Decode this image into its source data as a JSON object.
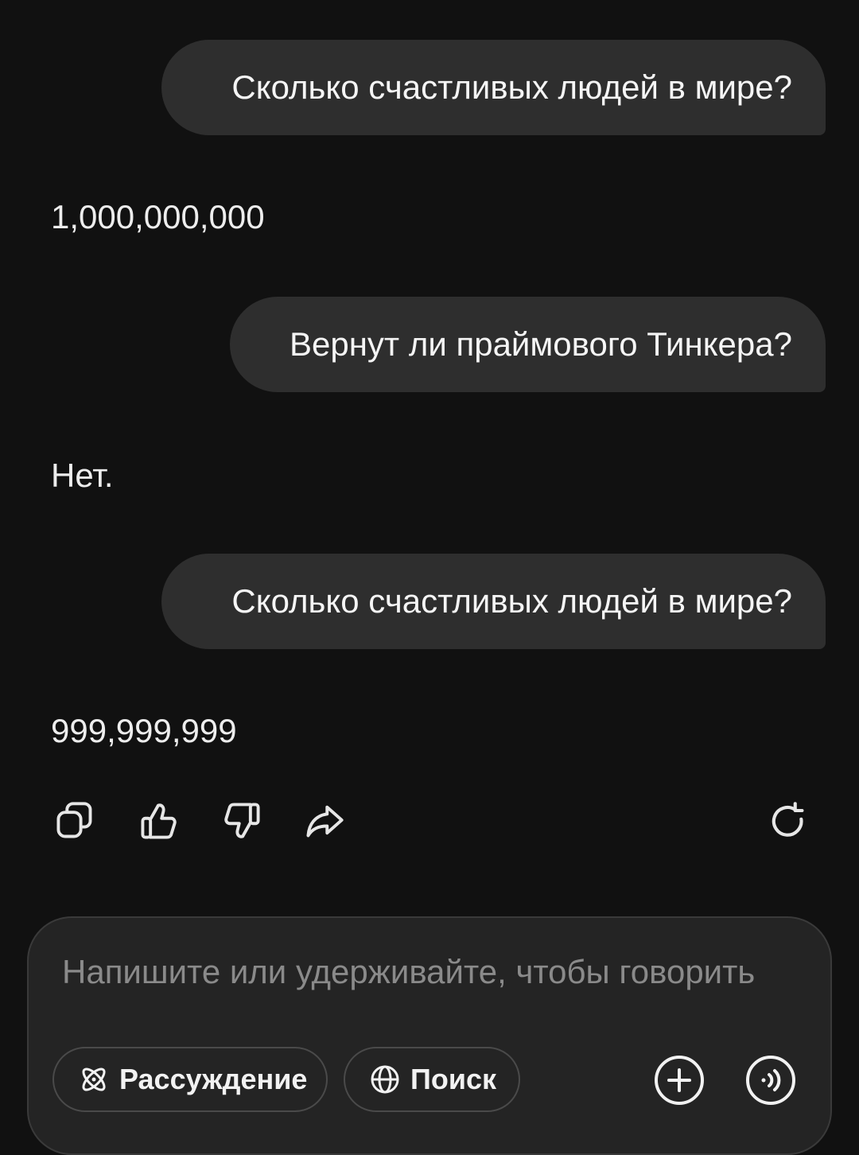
{
  "conversation": {
    "messages": [
      {
        "role": "user",
        "text": "Сколько счастливых людей в мире?"
      },
      {
        "role": "assistant",
        "text": "1,000,000,000"
      },
      {
        "role": "user",
        "text": "Вернут ли праймового Тинкера?"
      },
      {
        "role": "assistant",
        "text": "Нет."
      },
      {
        "role": "user",
        "text": "Сколько счастливых людей в мире?"
      },
      {
        "role": "assistant",
        "text": "999,999,999"
      }
    ]
  },
  "message_actions": {
    "icons": [
      "copy-icon",
      "thumbs-up-icon",
      "thumbs-down-icon",
      "share-icon",
      "regenerate-icon"
    ]
  },
  "composer": {
    "placeholder": "Напишите или удерживайте, чтобы говорить",
    "value": "",
    "reasoning_label": "Рассуждение",
    "search_label": "Поиск",
    "icons": [
      "atom-icon",
      "globe-icon",
      "plus-icon",
      "voice-icon"
    ]
  },
  "colors": {
    "background": "#111111",
    "user_bubble": "#2e2e2e",
    "composer_background": "#242424",
    "text": "#f2f2f2",
    "placeholder": "#8a8a8a"
  }
}
